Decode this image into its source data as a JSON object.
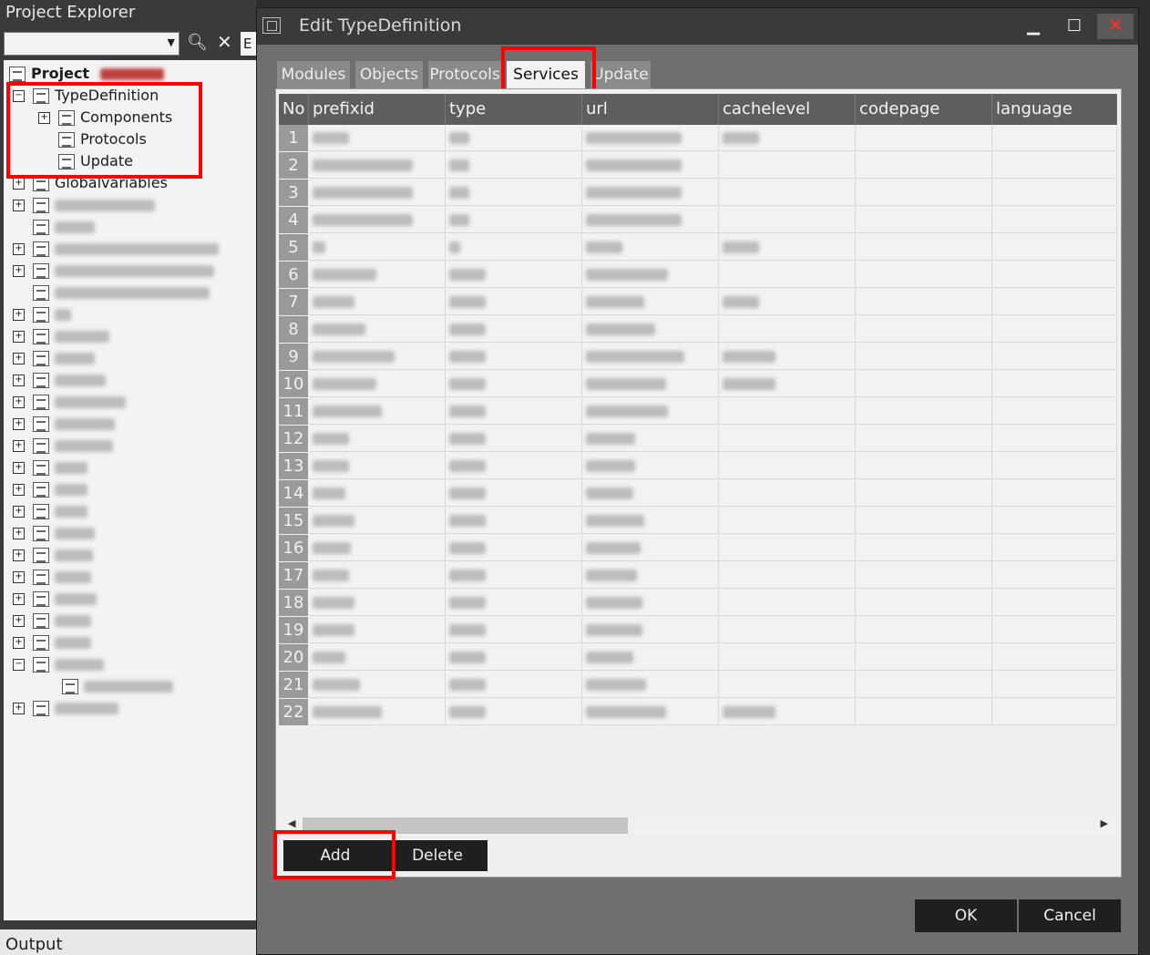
{
  "explorer": {
    "title": "Project Explorer",
    "filter_label": "E",
    "tree": {
      "project_label": "Project",
      "typedef_label": "TypeDefinition",
      "components_label": "Components",
      "protocols_label": "Protocols",
      "update_label": "Update",
      "globalvariables_label": "Globalvariables"
    }
  },
  "output": {
    "label": "Output"
  },
  "dialog": {
    "title": "Edit TypeDefinition",
    "tabs": [
      "Modules",
      "Objects",
      "Protocols",
      "Services",
      "Update"
    ],
    "active_tab": "Services",
    "columns": [
      "No",
      "prefixid",
      "type",
      "url",
      "cachelevel",
      "codepage",
      "language"
    ],
    "row_numbers": [
      "1",
      "2",
      "3",
      "4",
      "5",
      "6",
      "7",
      "8",
      "9",
      "10",
      "11",
      "12",
      "13",
      "14",
      "15",
      "16",
      "17",
      "18",
      "19",
      "20",
      "21",
      "22"
    ],
    "add_label": "Add",
    "delete_label": "Delete",
    "ok_label": "OK",
    "cancel_label": "Cancel"
  },
  "colors": {
    "highlight": "#ff0000",
    "dialog_bg": "#6f6f6f",
    "header_bg": "#5e5e5e",
    "button_bg": "#1f1f1f"
  }
}
